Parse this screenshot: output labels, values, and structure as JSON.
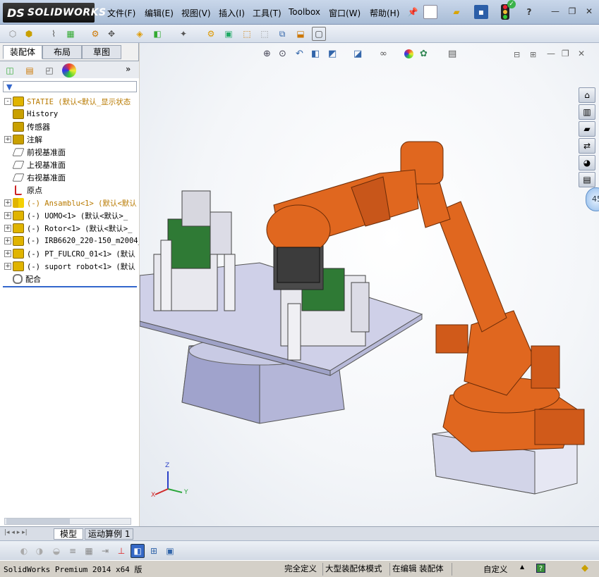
{
  "app": {
    "logo_ds": "DS",
    "logo_text": "SOLIDWORKS"
  },
  "menu": {
    "items": [
      "文件(F)",
      "编辑(E)",
      "视图(V)",
      "插入(I)",
      "工具(T)",
      "Toolbox",
      "窗口(W)",
      "帮助(H)"
    ]
  },
  "feature_manager": {
    "tabs": [
      "装配体",
      "布局",
      "草图"
    ],
    "tree": [
      {
        "label": "STATIE  (默认<默认_显示状态",
        "icon": "assembly-icon",
        "expand": "-",
        "style": "orange"
      },
      {
        "label": "History",
        "icon": "history-icon",
        "expand": "",
        "style": "mono"
      },
      {
        "label": "传感器",
        "icon": "sensor-icon",
        "expand": "",
        "style": "normal"
      },
      {
        "label": "注解",
        "icon": "annotation-icon",
        "expand": "+",
        "style": "normal"
      },
      {
        "label": "前视基准面",
        "icon": "plane-icon",
        "expand": "",
        "style": "normal"
      },
      {
        "label": "上视基准面",
        "icon": "plane-icon",
        "expand": "",
        "style": "normal"
      },
      {
        "label": "右视基准面",
        "icon": "plane-icon",
        "expand": "",
        "style": "normal"
      },
      {
        "label": "原点",
        "icon": "origin-icon",
        "expand": "",
        "style": "normal"
      },
      {
        "label": "(-) Ansamblu<1> (默认<默认",
        "icon": "warning-assembly-icon",
        "expand": "+",
        "style": "orange"
      },
      {
        "label": "(-) UOMO<1> (默认<默认>_",
        "icon": "part-icon",
        "expand": "+",
        "style": "mono"
      },
      {
        "label": "(-) Rotor<1> (默认<默认>_",
        "icon": "part-icon",
        "expand": "+",
        "style": "mono"
      },
      {
        "label": "(-) IRB6620_220-150_m2004_",
        "icon": "part-icon",
        "expand": "+",
        "style": "mono"
      },
      {
        "label": "(-) PT_FULCRO_01<1> (默认",
        "icon": "part-icon",
        "expand": "+",
        "style": "mono"
      },
      {
        "label": "(-) suport robot<1> (默认",
        "icon": "part-icon",
        "expand": "+",
        "style": "mono"
      },
      {
        "label": "配合",
        "icon": "mates-icon",
        "expand": "",
        "style": "normal"
      }
    ]
  },
  "viewport": {
    "triad": {
      "z": "Z",
      "y": "Y",
      "x": "X"
    },
    "badge": "45"
  },
  "bottom_tabs": [
    "模型",
    "运动算例 1"
  ],
  "status": {
    "product": "SolidWorks Premium 2014 x64 版",
    "state": "完全定义",
    "mode": "大型装配体模式",
    "editing": "在编辑 装配体",
    "units": "自定义",
    "arrow": "▲",
    "help": "?"
  }
}
